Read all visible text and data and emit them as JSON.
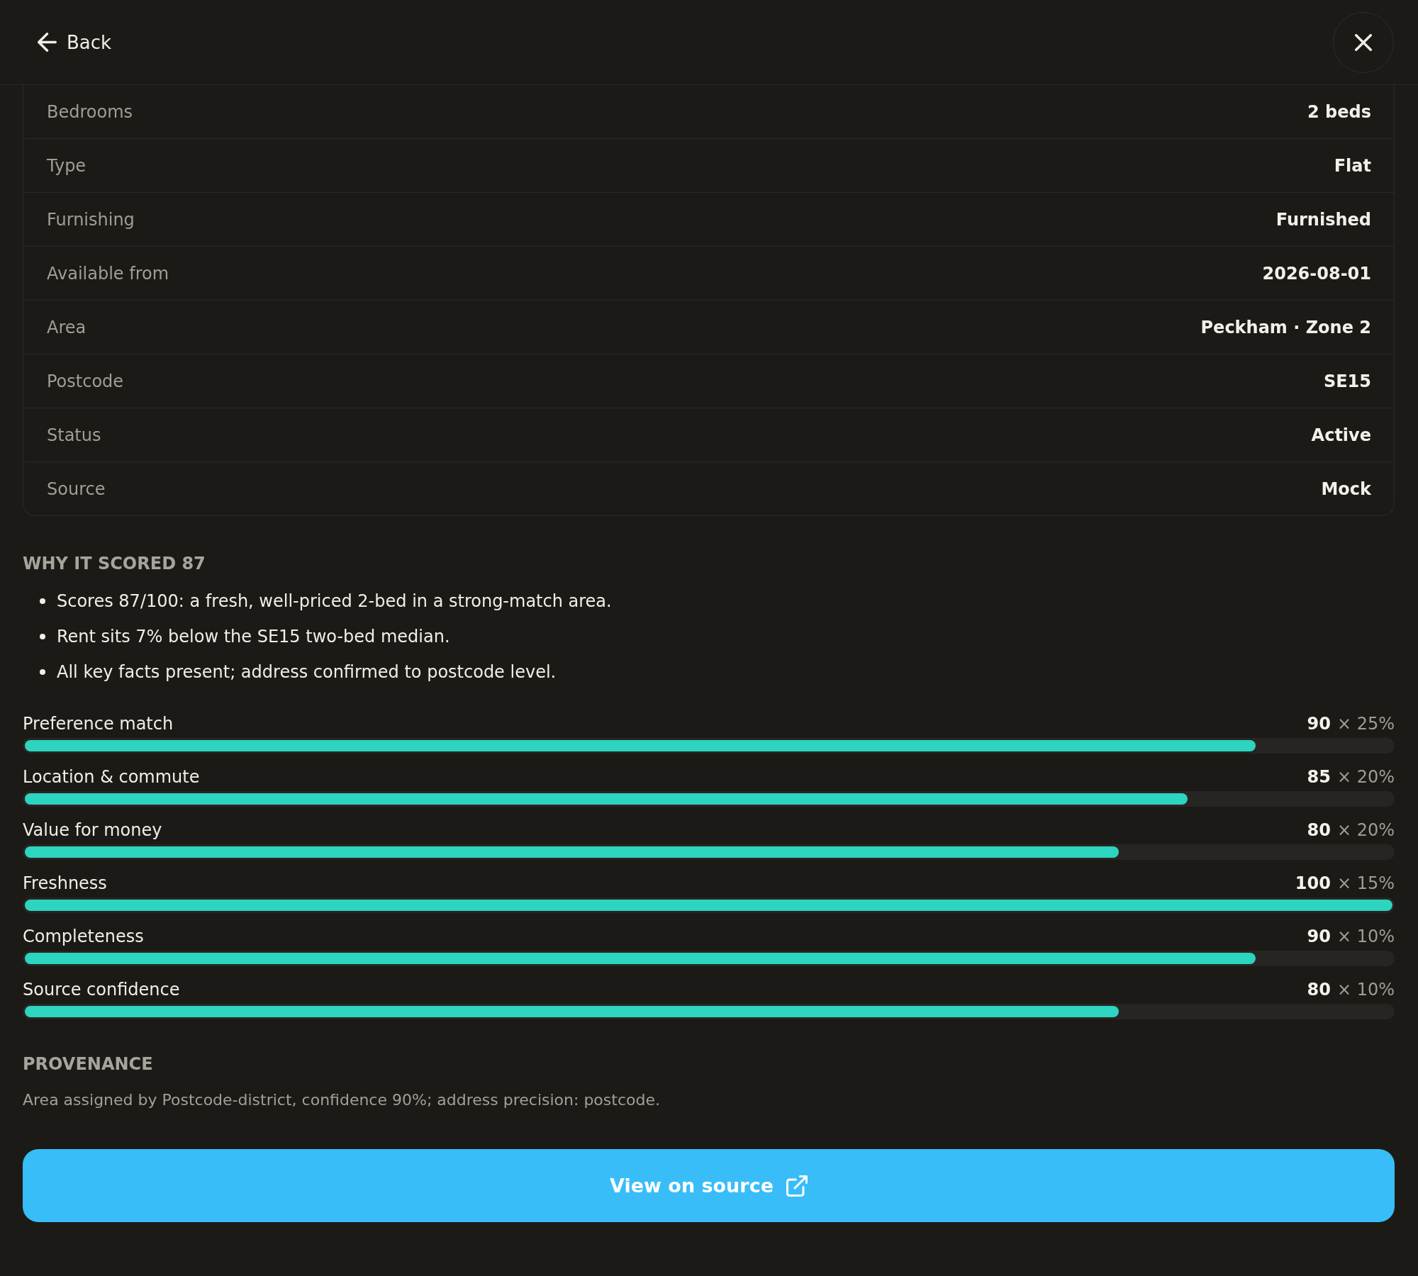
{
  "header": {
    "back_label": "Back"
  },
  "details": [
    {
      "label": "Bedrooms",
      "value": "2 beds"
    },
    {
      "label": "Type",
      "value": "Flat"
    },
    {
      "label": "Furnishing",
      "value": "Furnished"
    },
    {
      "label": "Available from",
      "value": "2026-08-01"
    },
    {
      "label": "Area",
      "value": "Peckham · Zone 2"
    },
    {
      "label": "Postcode",
      "value": "SE15"
    },
    {
      "label": "Status",
      "value": "Active"
    },
    {
      "label": "Source",
      "value": "Mock"
    }
  ],
  "score_section": {
    "title": "WHY IT SCORED 87",
    "reasons": [
      "Scores 87/100: a fresh, well-priced 2-bed in a strong-match area.",
      "Rent sits 7% below the SE15 two-bed median.",
      "All key facts present; address confirmed to postcode level."
    ]
  },
  "factors": [
    {
      "label": "Preference match",
      "score": "90",
      "weight": "× 25%",
      "level": 0.9
    },
    {
      "label": "Location & commute",
      "score": "85",
      "weight": "× 20%",
      "level": 0.85
    },
    {
      "label": "Value for money",
      "score": "80",
      "weight": "× 20%",
      "level": 0.8
    },
    {
      "label": "Freshness",
      "score": "100",
      "weight": "× 15%",
      "level": 1.0
    },
    {
      "label": "Completeness",
      "score": "90",
      "weight": "× 10%",
      "level": 0.9
    },
    {
      "label": "Source confidence",
      "score": "80",
      "weight": "× 10%",
      "level": 0.8
    }
  ],
  "provenance": {
    "title": "PROVENANCE",
    "text": "Area assigned by Postcode-district, confidence 90%; address precision: postcode."
  },
  "action_button": {
    "label": "View on source"
  }
}
